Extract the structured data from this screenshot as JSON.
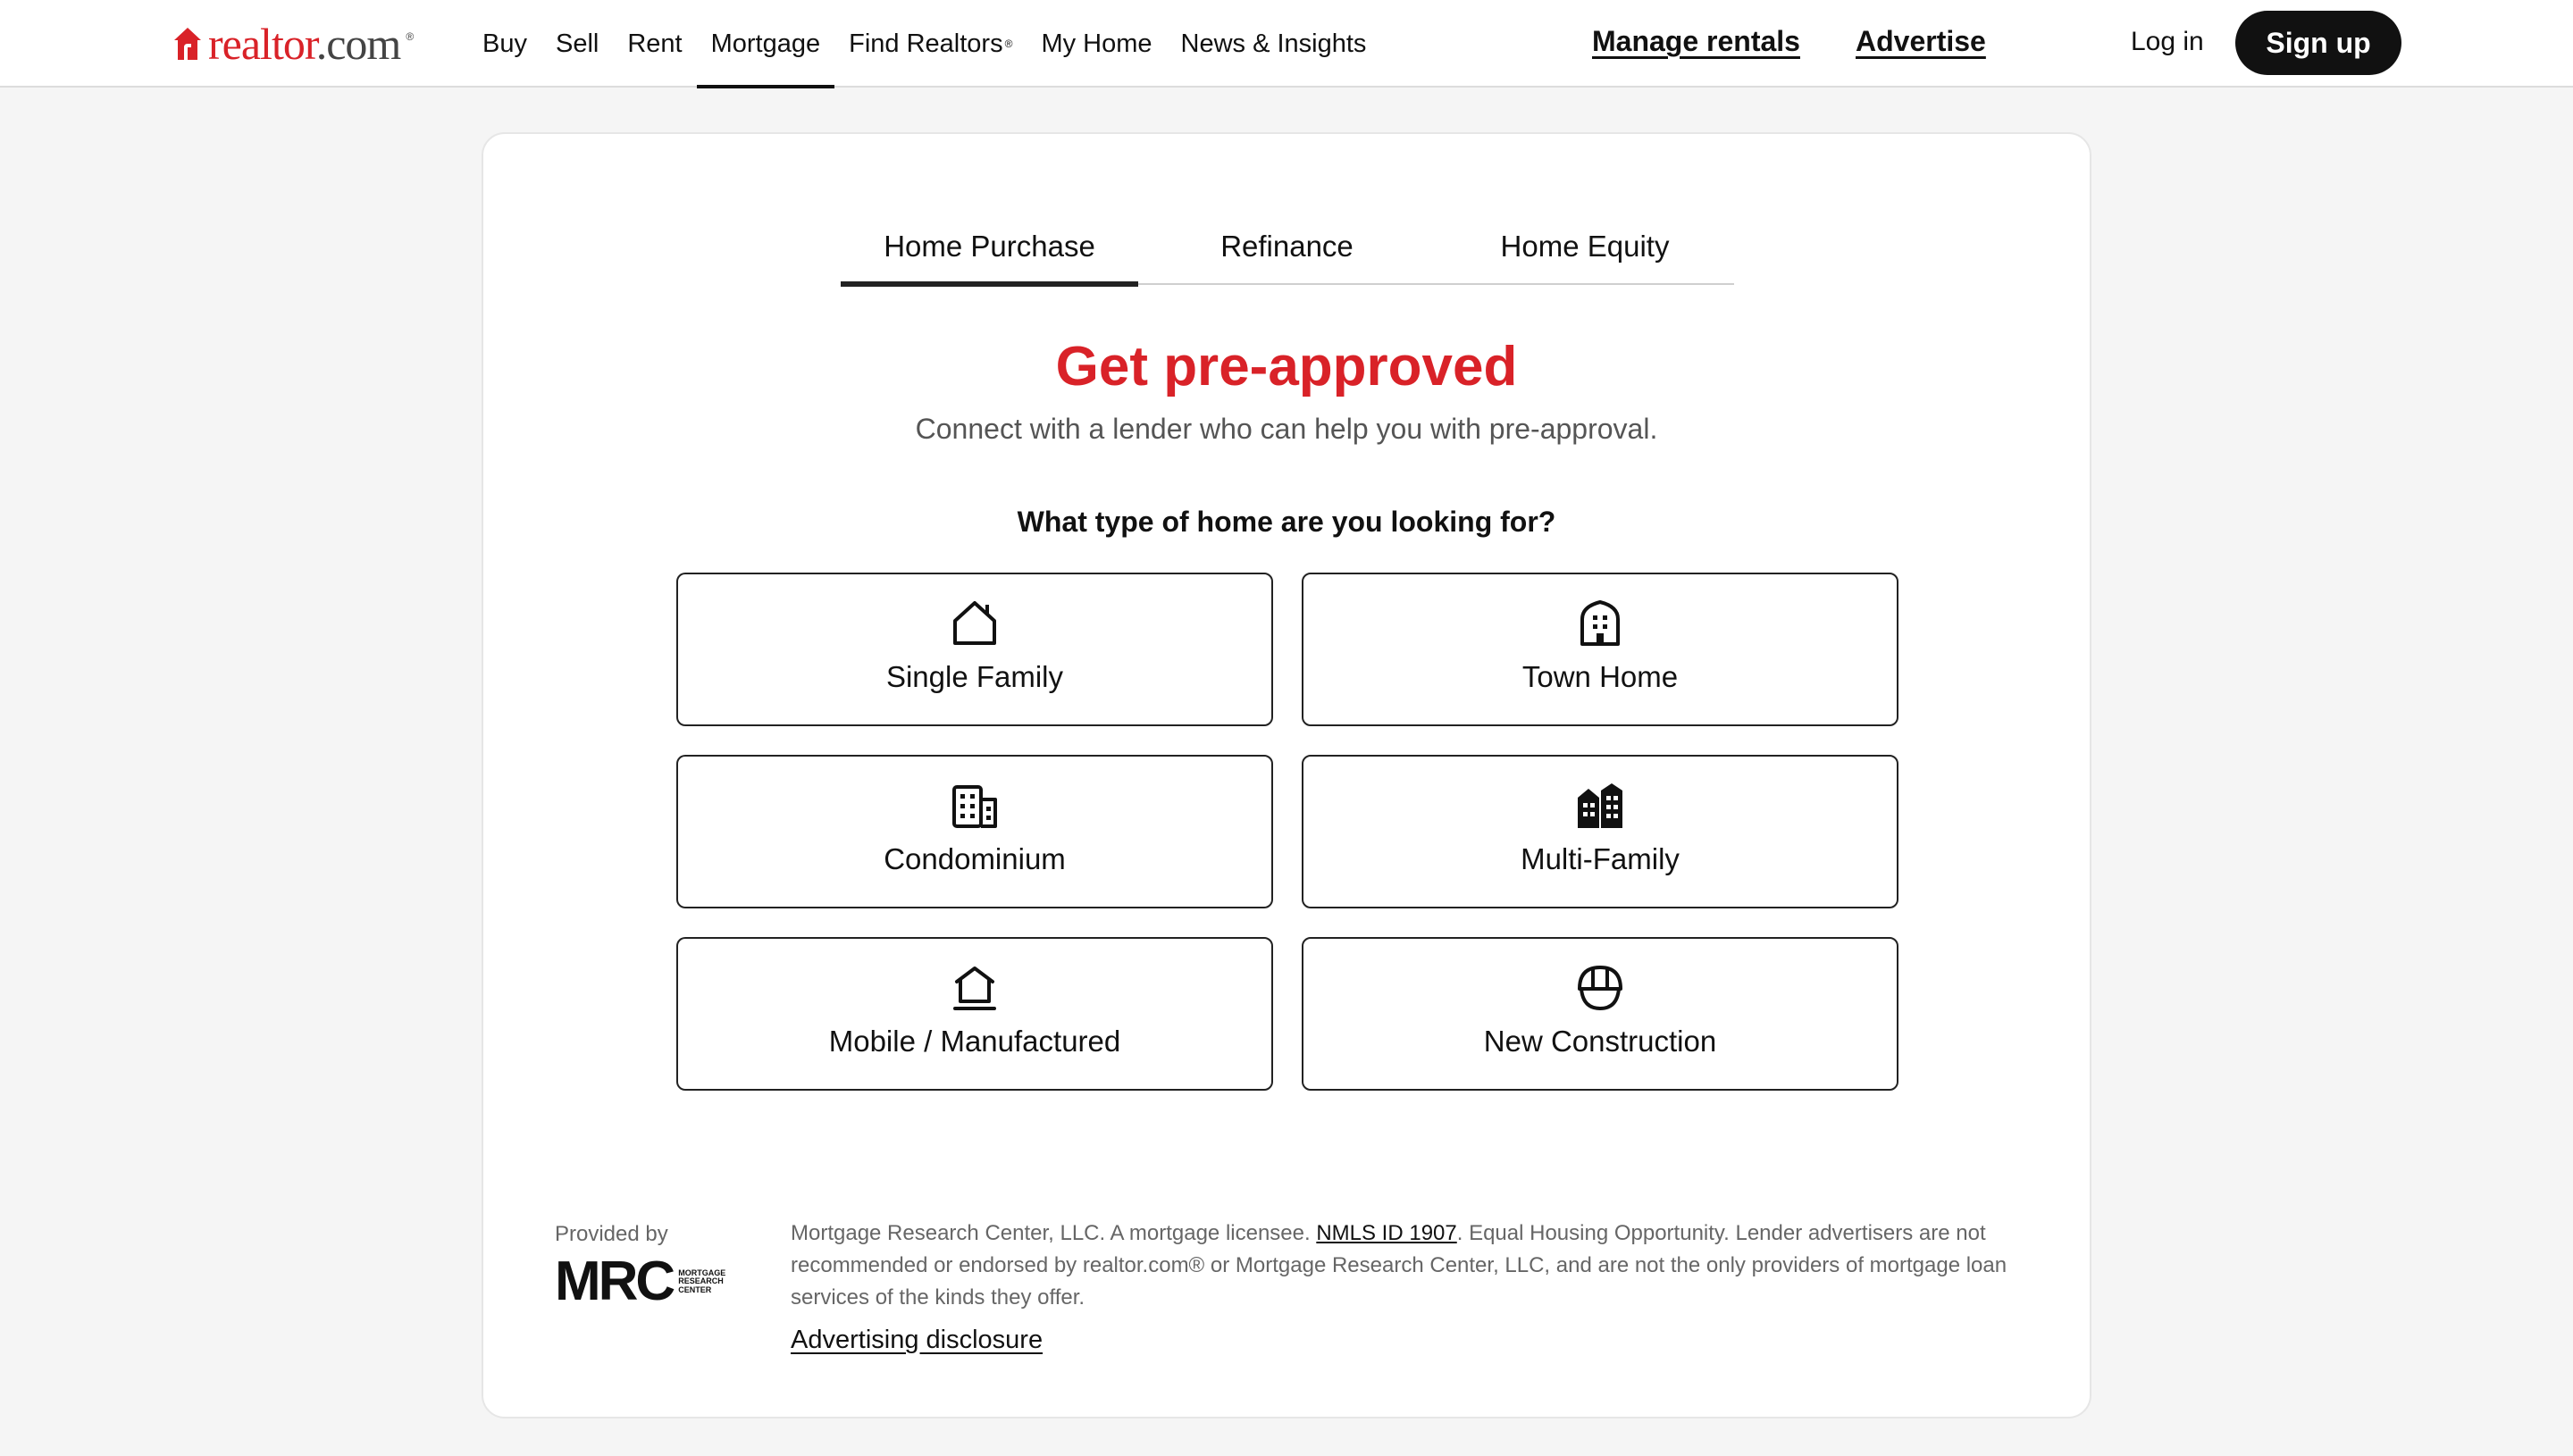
{
  "brand": {
    "logo_text_r": "real",
    "logo_text_rest": "tor",
    "logo_text_dot": ".com",
    "logo_reg": "®",
    "accent": "#d92228"
  },
  "nav": {
    "items": [
      {
        "label": "Buy"
      },
      {
        "label": "Sell"
      },
      {
        "label": "Rent"
      },
      {
        "label": "Mortgage",
        "active": true
      },
      {
        "label": "Find Realtors",
        "sup": "®"
      },
      {
        "label": "My Home"
      },
      {
        "label": "News & Insights"
      }
    ],
    "manage_rentals": "Manage rentals",
    "advertise": "Advertise",
    "login": "Log in",
    "signup": "Sign up"
  },
  "tabs": [
    {
      "label": "Home Purchase",
      "active": true
    },
    {
      "label": "Refinance"
    },
    {
      "label": "Home Equity"
    }
  ],
  "hero": {
    "title": "Get pre-approved",
    "subtitle": "Connect with a lender who can help you with pre-approval."
  },
  "question": "What type of home are you looking for?",
  "options": [
    {
      "label": "Single Family",
      "icon": "house-icon"
    },
    {
      "label": "Town Home",
      "icon": "townhome-icon"
    },
    {
      "label": "Condominium",
      "icon": "condo-building-icon"
    },
    {
      "label": "Multi-Family",
      "icon": "multifamily-building-icon"
    },
    {
      "label": "Mobile / Manufactured",
      "icon": "mobile-home-icon"
    },
    {
      "label": "New Construction",
      "icon": "hard-hat-icon"
    }
  ],
  "footer": {
    "provided_by": "Provided by",
    "mrc_big": "MRC",
    "mrc_small": "MORTGAGE RESEARCH CENTER",
    "disclaimer_pre": "Mortgage Research Center, LLC. A mortgage licensee. ",
    "nmls": "NMLS ID 1907",
    "disclaimer_post": ". Equal Housing Opportunity. Lender advertisers are not recommended or endorsed by realtor.com® or Mortgage Research Center, LLC, and are not the only providers of mortgage loan services of the kinds they offer.",
    "ad_disclosure": "Advertising disclosure"
  }
}
